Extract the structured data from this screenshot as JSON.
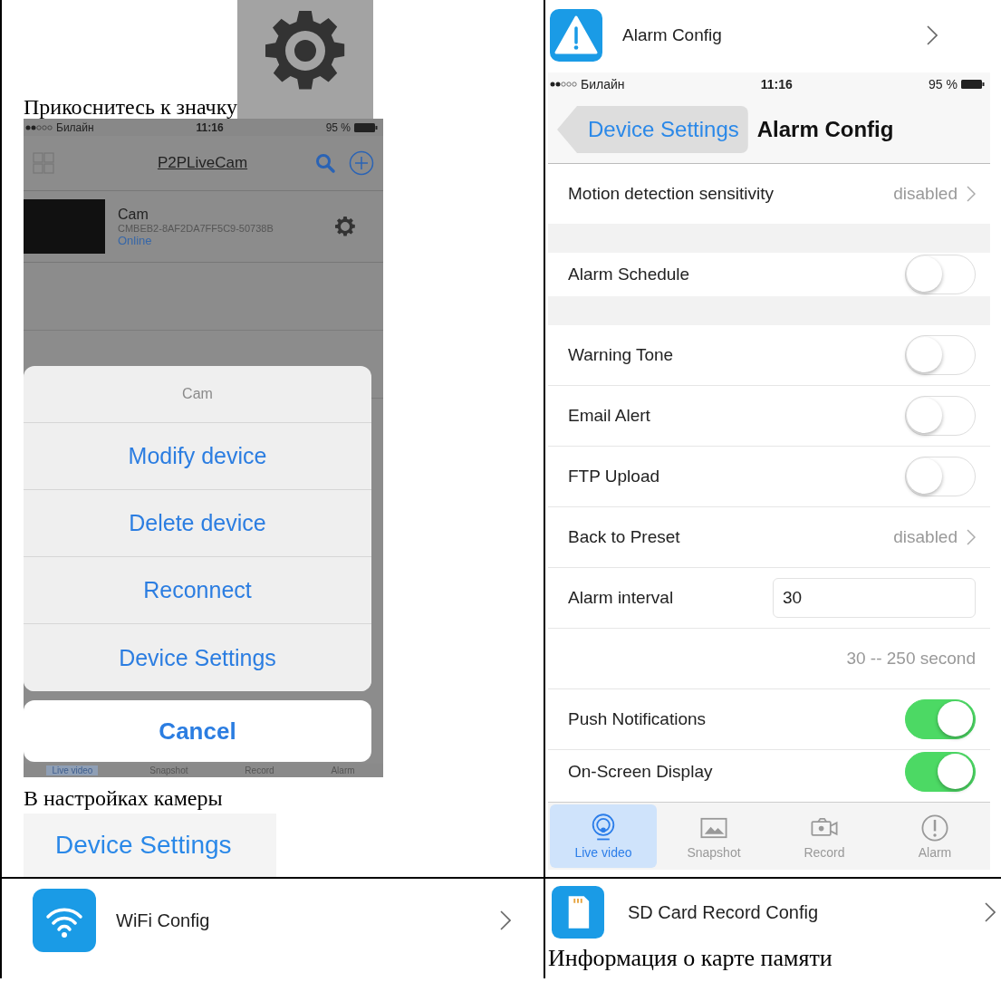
{
  "gear_caption": "Прикоснитесь к значку",
  "device_list_screen": {
    "status_bar": {
      "carrier": "Билайн",
      "time": "11:16",
      "battery": "95 %"
    },
    "title": "P2PLiveCam",
    "device": {
      "name": "Cam",
      "serial": "CMBEB2-8AF2DA7FF5C9-50738B",
      "status": "Online"
    },
    "action_sheet": {
      "title": "Cam",
      "actions": [
        "Modify device",
        "Delete device",
        "Reconnect",
        "Device Settings"
      ],
      "cancel": "Cancel"
    },
    "tab_bar": [
      {
        "label": "Live video",
        "selected": true
      },
      {
        "label": "Snapshot",
        "selected": false
      },
      {
        "label": "Record",
        "selected": false
      },
      {
        "label": "Alarm",
        "selected": false
      }
    ]
  },
  "settings_caption": "В настройках камеры",
  "settings_button": "Device Settings",
  "alarm_menu_item": {
    "label": "Alarm Config"
  },
  "alarm_screen": {
    "status_bar": {
      "carrier": "Билайн",
      "time": "11:16",
      "battery": "95 %"
    },
    "back": "Device Settings",
    "title": "Alarm Config",
    "sections": [
      [
        {
          "kind": "value",
          "label": "Motion detection sensitivity",
          "value": "disabled"
        }
      ],
      [
        {
          "kind": "switch",
          "label": "Alarm Schedule",
          "on": false
        }
      ],
      [
        {
          "kind": "switch",
          "label": "Warning Tone",
          "on": false
        },
        {
          "kind": "switch",
          "label": "Email Alert",
          "on": false
        },
        {
          "kind": "switch",
          "label": "FTP Upload",
          "on": false
        },
        {
          "kind": "value",
          "label": "Back to Preset",
          "value": "disabled"
        },
        {
          "kind": "input",
          "label": "Alarm interval",
          "value": "30"
        },
        {
          "kind": "hint",
          "text": "30 -- 250 second"
        },
        {
          "kind": "switch",
          "label": "Push Notifications",
          "on": true
        },
        {
          "kind": "switch",
          "label": "On-Screen Display",
          "on": true
        }
      ]
    ],
    "tab_bar": [
      {
        "label": "Live video",
        "selected": true
      },
      {
        "label": "Snapshot",
        "selected": false
      },
      {
        "label": "Record",
        "selected": false
      },
      {
        "label": "Alarm",
        "selected": false
      }
    ]
  },
  "wifi_menu_item": {
    "label": "WiFi Config"
  },
  "sd_menu_item": {
    "label": "SD Card Record Config"
  },
  "memory_caption": "Информация о карте памяти"
}
